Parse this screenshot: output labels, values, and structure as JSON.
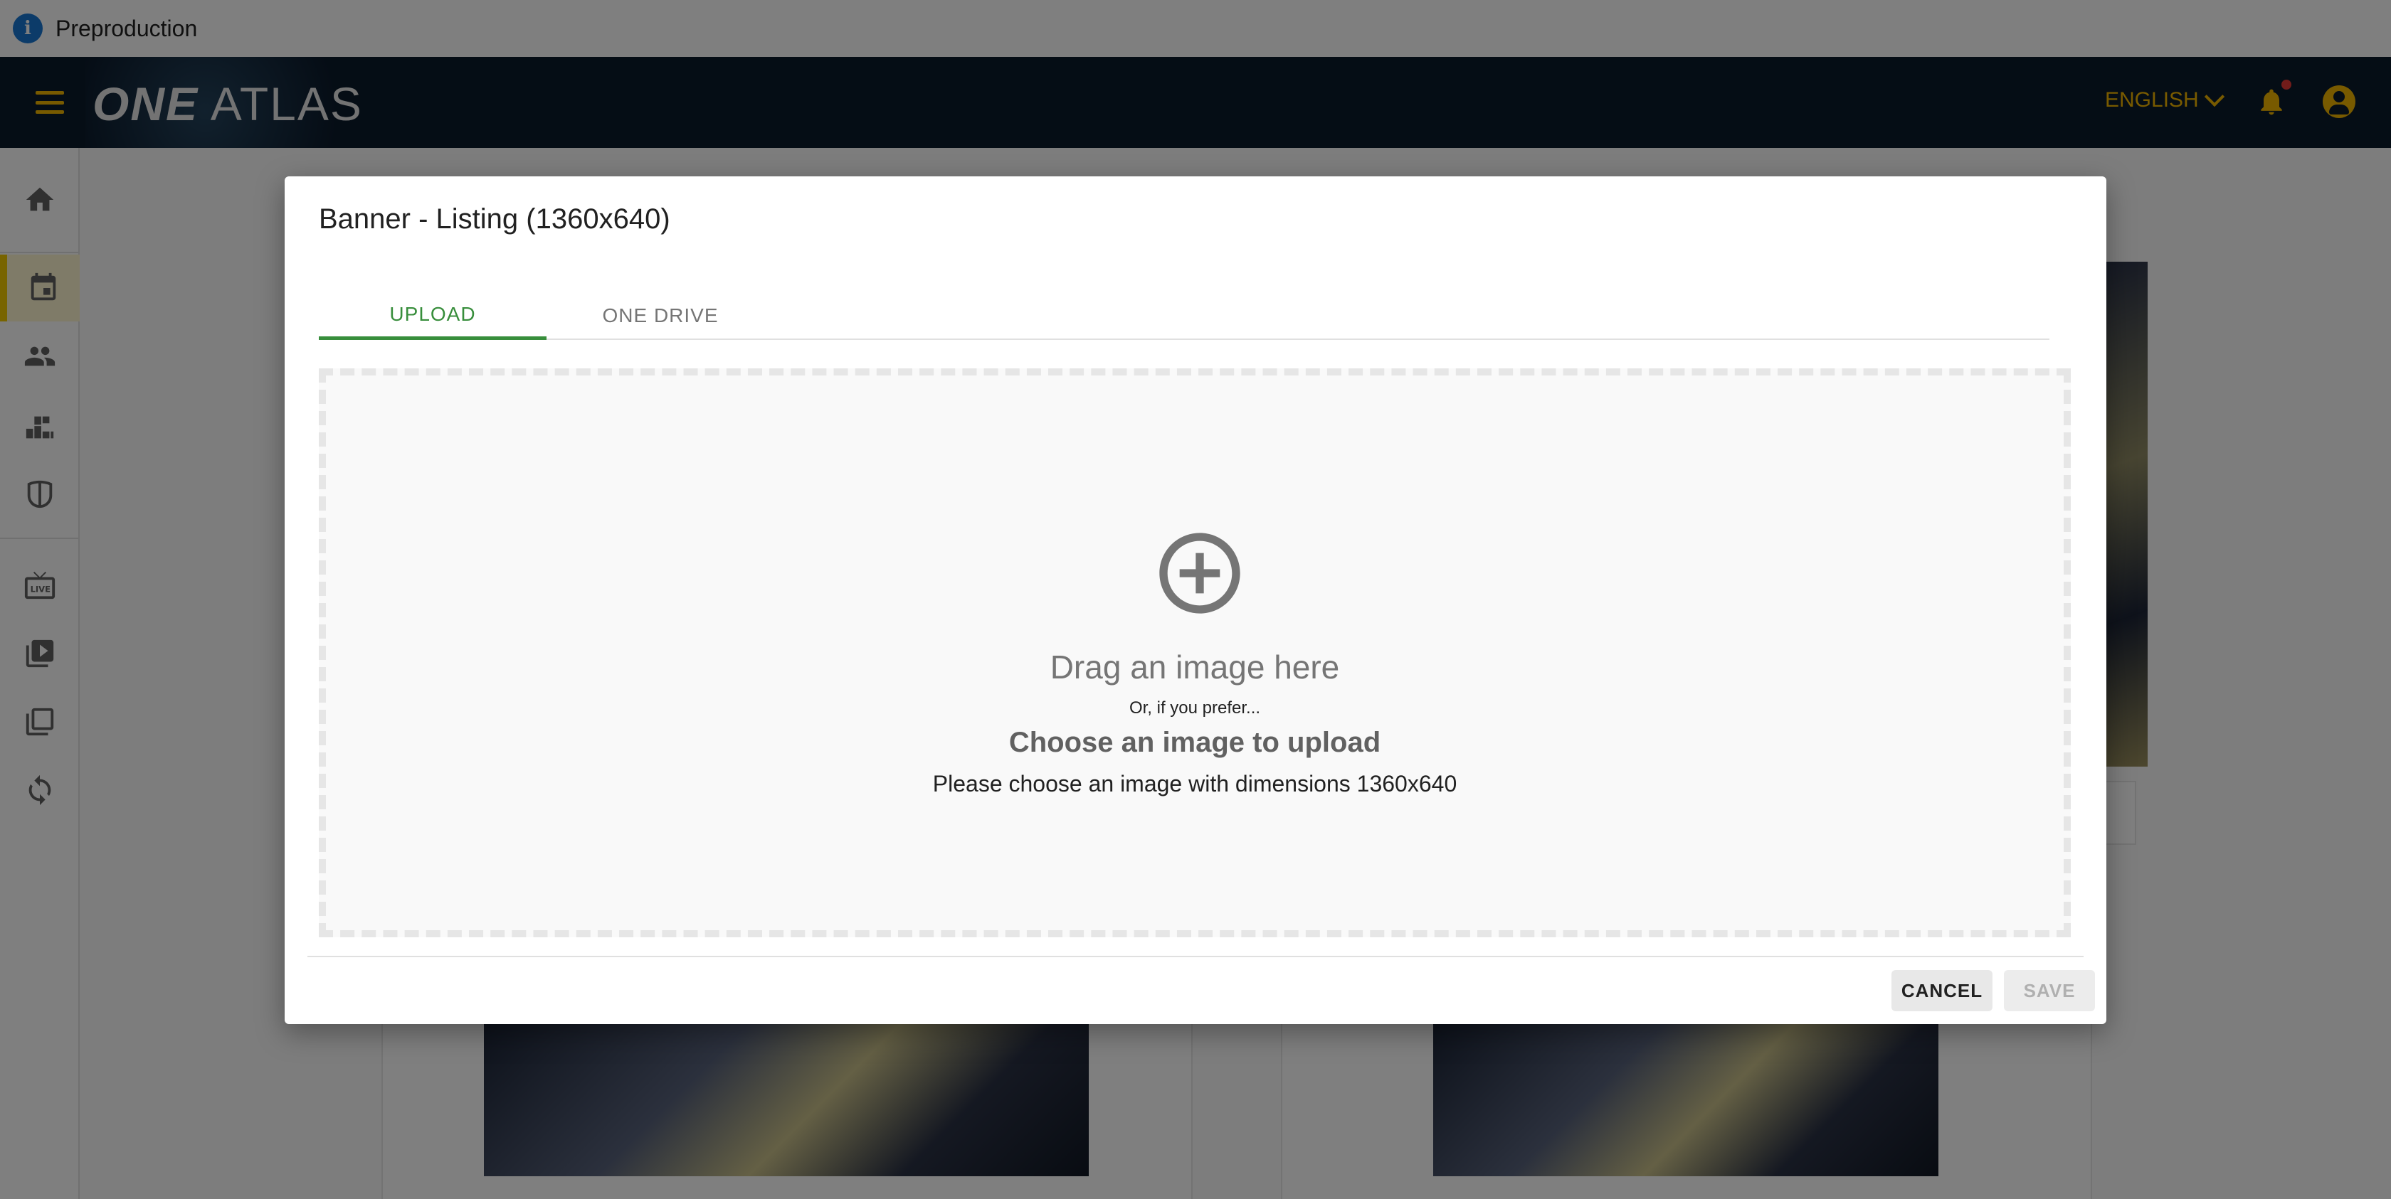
{
  "env_banner": {
    "text": "Preproduction",
    "icon": "info-icon"
  },
  "header": {
    "logo_one": "ONE",
    "logo_atlas": "ATLAS",
    "language": "ENGLISH",
    "colors": {
      "bar": "#0b1a2b",
      "accent": "#f0b400"
    }
  },
  "sidebar": {
    "items": [
      {
        "icon": "home-icon"
      },
      {
        "icon": "calendar-icon",
        "active": true
      },
      {
        "icon": "people-icon"
      },
      {
        "icon": "podium-icon"
      },
      {
        "icon": "jersey-icon"
      },
      {
        "icon": "live-tv-icon"
      },
      {
        "icon": "video-library-icon"
      },
      {
        "icon": "collections-icon"
      },
      {
        "icon": "sync-icon"
      }
    ]
  },
  "dialog": {
    "title": "Banner - Listing (1360x640)",
    "tabs": [
      {
        "label": "UPLOAD",
        "active": true
      },
      {
        "label": "ONE DRIVE",
        "active": false
      }
    ],
    "dropzone": {
      "icon": "add-circle-icon",
      "title": "Drag an image here",
      "or_text": "Or, if you prefer...",
      "choose_text": "Choose an image to upload",
      "hint": "Please choose an image with dimensions 1360x640"
    },
    "actions": {
      "cancel": "CANCEL",
      "save": "SAVE"
    },
    "accent_color": "#388e3c"
  }
}
